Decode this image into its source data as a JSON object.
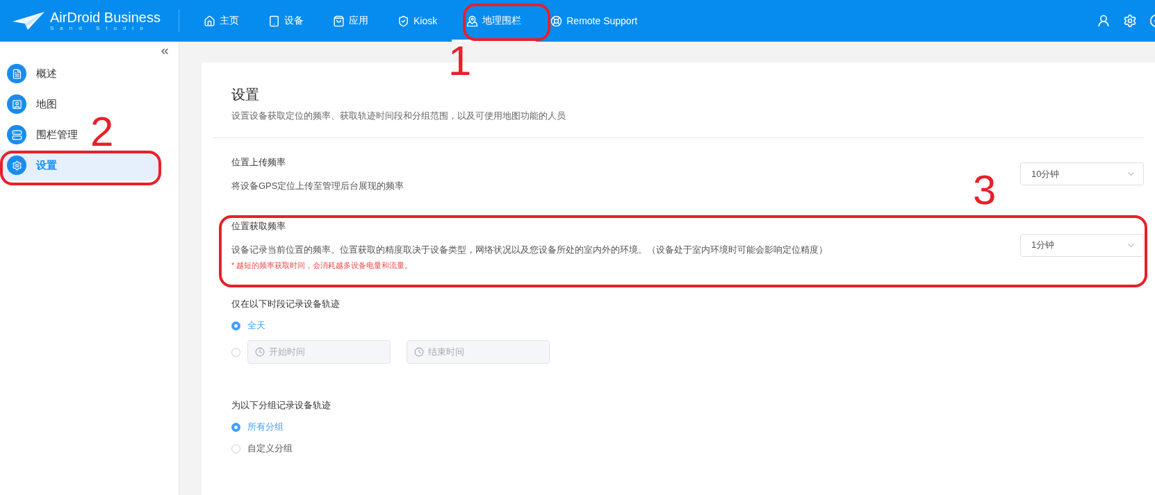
{
  "header": {
    "logo": {
      "name": "AirDroid Business",
      "tagline": "Sand Studio"
    },
    "nav": [
      {
        "label": "主页",
        "selected": false
      },
      {
        "label": "设备",
        "selected": false
      },
      {
        "label": "应用",
        "selected": false
      },
      {
        "label": "Kiosk",
        "selected": false
      },
      {
        "label": "地理围栏",
        "selected": true
      },
      {
        "label": "Remote Support",
        "selected": false
      }
    ]
  },
  "sidebar": {
    "items": [
      {
        "label": "概述",
        "selected": false
      },
      {
        "label": "地图",
        "selected": false
      },
      {
        "label": "围栏管理",
        "selected": false
      },
      {
        "label": "设置",
        "selected": true
      }
    ]
  },
  "page": {
    "title": "设置",
    "subtitle": "设置设备获取定位的频率、获取轨迹时间段和分组范围，以及可使用地图功能的人员"
  },
  "settings": [
    {
      "kind": "select",
      "label": "位置上传频率",
      "description": "将设备GPS定位上传至管理后台展现的频率",
      "value": "10分钟"
    },
    {
      "kind": "select",
      "label": "位置获取频率",
      "description": "设备记录当前位置的频率。位置获取的精度取决于设备类型，网络状况以及您设备所处的室内外的环境。（设备处于室内环境时可能会影响定位精度）",
      "warning": "* 越短的频率获取时间，会消耗越多设备电量和流量。",
      "value": "1分钟"
    },
    {
      "kind": "radio",
      "label": "仅在以下时段记录设备轨迹",
      "options": [
        {
          "kind": "text",
          "label": "全天",
          "selected": true
        },
        {
          "kind": "time_range",
          "start_placeholder": "开始时间",
          "end_placeholder": "结束时间",
          "selected": false
        }
      ]
    },
    {
      "kind": "radio",
      "label": "为以下分组记录设备轨迹",
      "options": [
        {
          "kind": "text",
          "label": "所有分组",
          "selected": true
        },
        {
          "kind": "text",
          "label": "自定义分组",
          "selected": false
        }
      ]
    }
  ],
  "annotations": [
    {
      "label": "1"
    },
    {
      "label": "2"
    },
    {
      "label": "3"
    }
  ]
}
